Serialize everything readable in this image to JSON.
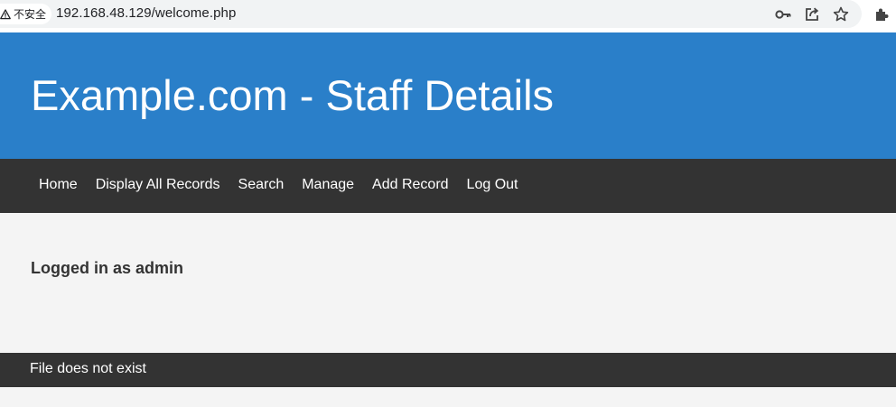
{
  "browser": {
    "security_label": "不安全",
    "url": "192.168.48.129/welcome.php",
    "icons": [
      "warning-icon",
      "key-icon",
      "share-icon",
      "star-icon",
      "extensions-icon"
    ]
  },
  "header": {
    "title": "Example.com - Staff Details",
    "background_color": "#2a7fc9"
  },
  "nav": {
    "background_color": "#333333",
    "items": [
      {
        "label": "Home"
      },
      {
        "label": "Display All Records"
      },
      {
        "label": "Search"
      },
      {
        "label": "Manage"
      },
      {
        "label": "Add Record"
      },
      {
        "label": "Log Out"
      }
    ]
  },
  "main": {
    "status_text": "Logged in as admin"
  },
  "footer": {
    "text": "File does not exist"
  }
}
